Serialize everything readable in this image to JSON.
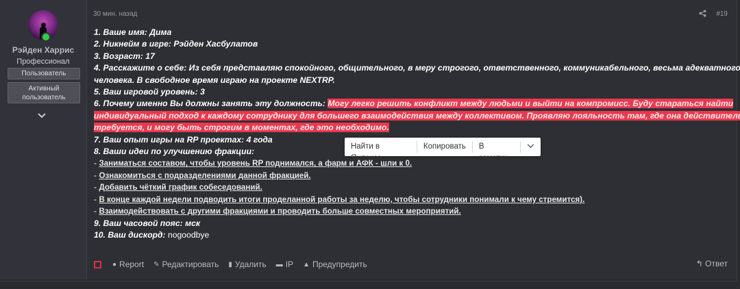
{
  "user": {
    "name": "Рэйден Харрис",
    "title": "Профессионал",
    "badges": [
      "Пользователь",
      "Активный пользователь"
    ]
  },
  "post": {
    "time": "30 мин. назад",
    "number": "#19",
    "lines": {
      "l1": "1. Ваше имя: Дима",
      "l2": "2. Никнейм в игре: Рэйден Хасбулатов",
      "l3": "3. Возраст: 17",
      "l4a": "4. Расскажите о себе: Из себя представляю спокойного, общительного, в меру строгого, ответственного, коммуникабельного, весьма адекватного",
      "l4b": "человека. В свободное время играю на проекте NEXTRP.",
      "l5": "5. Ваш игровой уровень: 3",
      "l6q": "6. Почему именно Вы должны занять эту должность:",
      "l6h1": "Могу легко решить конфликт между людьми и выйти на компромисс. Буду стараться найти",
      "l6h2": "индивидуальный подход к каждому сотруднику для большего взаимодействия между коллективом. Проявляю лояльность там, где она действительно",
      "l6h3": "требуется, и могу быть строгим в моментах, где это необходимо.",
      "l7": "7. Ваш опыт игры на RP проектах: 4 года",
      "l8": "8. Ваши идеи по улучшению фракции:",
      "ideas": [
        "Заниматься составом, чтобы уровень RP поднимался, а фарм и АФК - шли к 0.",
        "Ознакомиться с подразделениями данной фракцией.",
        "Добавить чёткий график собеседований.",
        "В конце каждой недели подводить итоги проделанной работы за неделю, чтобы сотрудники понимали к чему стремится).",
        "Взаимодействовать с другими фракциями и проводить больше совместных мероприятий."
      ],
      "l9": "9. Ваш часовой пояс: мск",
      "l10q": "10. Ваш дискорд:",
      "l10v": "nogoodbye"
    }
  },
  "context_menu": {
    "search": "Найти в Яндексе",
    "copy": "Копировать",
    "notes": "В заметки"
  },
  "actions": {
    "report": "Report",
    "edit": "Редактировать",
    "delete": "Удалить",
    "ip": "IP",
    "warn": "Предупредить",
    "reply": "Ответ"
  },
  "icons": [
    "share-icon",
    "info-icon",
    "pencil-icon",
    "trash-icon",
    "id-card-icon",
    "warning-icon",
    "reply-icon",
    "chevron-down-icon"
  ],
  "colors": {
    "highlight": "#e8394e",
    "online": "#2dcf44",
    "checkbox": "#e0303d"
  }
}
